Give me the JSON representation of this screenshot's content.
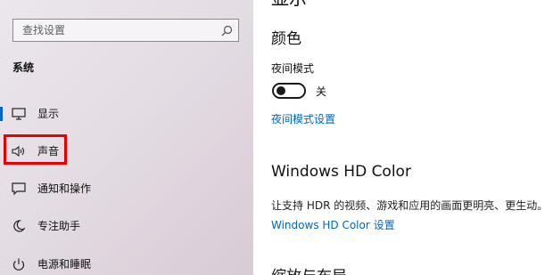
{
  "sidebar": {
    "search": {
      "placeholder": "查找设置",
      "icon": "search-icon"
    },
    "section_title": "系统",
    "items": [
      {
        "label": "显示",
        "icon": "monitor-icon",
        "active": true
      },
      {
        "label": "声音",
        "icon": "speaker-icon",
        "highlighted": true
      },
      {
        "label": "通知和操作",
        "icon": "notification-icon"
      },
      {
        "label": "专注助手",
        "icon": "moon-icon"
      },
      {
        "label": "电源和睡眠",
        "icon": "power-icon"
      }
    ],
    "highlight_color": "#e80000",
    "accent_color": "#0067c0"
  },
  "main": {
    "page_title": "显示",
    "color_heading": "颜色",
    "night_light": {
      "label": "夜间模式",
      "state": "关",
      "on": false,
      "settings_link": "夜间模式设置"
    },
    "hd_color": {
      "heading": "Windows HD Color",
      "description": "让支持 HDR 的视频、游戏和应用的画面更明亮、更生动。",
      "link": "Windows HD Color 设置"
    },
    "scale_heading": "缩放与布局"
  }
}
